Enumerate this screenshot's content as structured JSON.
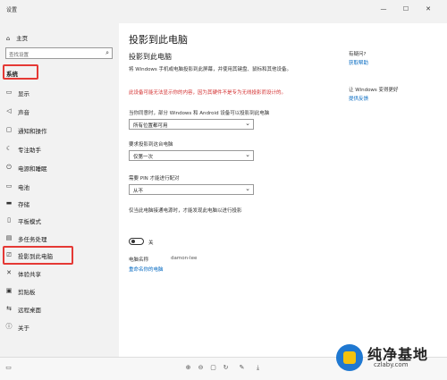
{
  "window": {
    "title": "设置",
    "minimize": "—",
    "maximize": "☐",
    "close": "✕"
  },
  "sidebar": {
    "home": "主页",
    "search_placeholder": "查找设置",
    "section_title": "系统",
    "items": [
      {
        "label": "显示",
        "icon": "display-icon"
      },
      {
        "label": "声音",
        "icon": "speaker-icon"
      },
      {
        "label": "通知和操作",
        "icon": "notification-icon"
      },
      {
        "label": "专注助手",
        "icon": "moon-icon"
      },
      {
        "label": "电源和睡眠",
        "icon": "power-icon"
      },
      {
        "label": "电池",
        "icon": "battery-icon"
      },
      {
        "label": "存储",
        "icon": "storage-icon"
      },
      {
        "label": "平板模式",
        "icon": "tablet-icon"
      },
      {
        "label": "多任务处理",
        "icon": "multitask-icon"
      },
      {
        "label": "投影到此电脑",
        "icon": "project-icon"
      },
      {
        "label": "体验共享",
        "icon": "share-icon"
      },
      {
        "label": "剪贴板",
        "icon": "clipboard-icon"
      },
      {
        "label": "远程桌面",
        "icon": "remote-icon"
      },
      {
        "label": "关于",
        "icon": "info-icon"
      }
    ]
  },
  "content": {
    "page_title": "投影到此电脑",
    "section_title": "投影到此电脑",
    "description": "将 Windows 手机或电脑投影到此屏幕，并使用其键盘、鼠标和其他设备。",
    "warning": "此设备可能无法显示你的内容，因为其硬件不是专为无线投影而设计的。",
    "setting1": {
      "label": "当你同意时，部分 Windows 和 Android 设备可以投影到此电脑",
      "value": "所有位置都可用"
    },
    "setting2": {
      "label": "要求投影到这台电脑",
      "value": "仅第一次"
    },
    "setting3": {
      "label": "需要 PIN 才能进行配对",
      "value": "从不"
    },
    "power": {
      "label": "仅当此电脑接通电源时，才能发现此电脑以进行投影",
      "state": "关"
    },
    "pc_name_label": "电脑名称",
    "pc_name_value": "damon-lee",
    "rename_link": "重命名你的电脑"
  },
  "right": {
    "question": "有疑问?",
    "help_link": "获取帮助",
    "improve": "让 Windows 变得更好",
    "feedback_link": "提供反馈"
  },
  "brand": {
    "name": "纯净基地",
    "url": "czlaby.com"
  },
  "colors": {
    "accent": "#0067c0",
    "warning": "#d32f2f",
    "highlight": "#e53935"
  }
}
